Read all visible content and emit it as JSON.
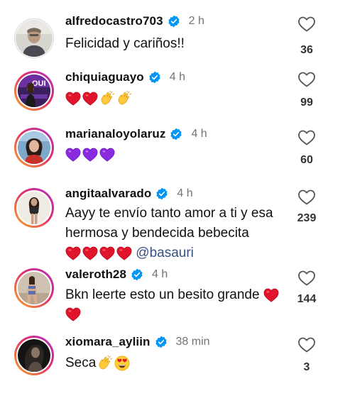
{
  "comments": [
    {
      "username": "alfredocastro703",
      "time": "2 h",
      "text": "Felicidad y cariños!!",
      "likes": "36"
    },
    {
      "username": "chiquiaguayo",
      "time": "4 h",
      "text": "",
      "likes": "99"
    },
    {
      "username": "marianaloyolaruz",
      "time": "4 h",
      "text": "",
      "likes": "60"
    },
    {
      "username": "angitaalvarado",
      "time": "4 h",
      "text": "Aayy te envío tanto amor a ti y esa hermosa y bendecida bebecita",
      "mention": "@basauri",
      "likes": "239"
    },
    {
      "username": "valeroth28",
      "time": "4 h",
      "text": "Bkn leerte esto  un besito grande",
      "likes": "144"
    },
    {
      "username": "xiomara_ayliin",
      "time": "38 min",
      "text": "Seca",
      "likes": "3"
    }
  ],
  "colors": {
    "verified": "#0095f6",
    "heart_red": "#e0142a",
    "purple": "#8a2be2",
    "story_ring_start": "#f9a826",
    "story_ring_end": "#b02fc5"
  },
  "icons": {
    "like": "heart-outline-icon",
    "verified": "verified-badge-icon"
  }
}
